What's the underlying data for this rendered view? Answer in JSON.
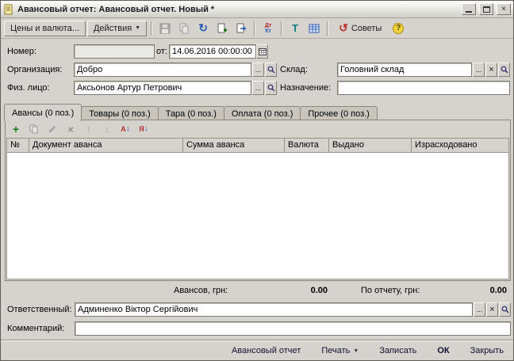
{
  "window": {
    "title": "Авансовый отчет: Авансовый отчет. Новый *"
  },
  "toolbar": {
    "prices_label": "Цены и валюта...",
    "actions_label": "Действия",
    "advices_label": "Советы"
  },
  "form": {
    "number_label": "Номер:",
    "number_value": "",
    "date_label": "от:",
    "date_value": "14.06.2016 00:00:00",
    "organization_label": "Организация:",
    "organization_value": "Добро",
    "warehouse_label": "Склад:",
    "warehouse_value": "Головний склад",
    "person_label": "Физ. лицо:",
    "person_value": "Аксьонов Артур Петрович",
    "purpose_label": "Назначение:",
    "purpose_value": "",
    "responsible_label": "Ответственный:",
    "responsible_value": "Админенко Віктор Сергійович",
    "comment_label": "Комментарий:",
    "comment_value": ""
  },
  "tabs": [
    {
      "label": "Авансы (0 поз.)"
    },
    {
      "label": "Товары (0 поз.)"
    },
    {
      "label": "Тара (0 поз.)"
    },
    {
      "label": "Оплата (0 поз.)"
    },
    {
      "label": "Прочее (0 поз.)"
    }
  ],
  "grid": {
    "columns": [
      "№",
      "Документ аванса",
      "Сумма аванса",
      "Валюта",
      "Выдано",
      "Израсходовано"
    ],
    "rows": []
  },
  "totals": {
    "advances_label": "Авансов, грн:",
    "advances_value": "0.00",
    "report_label": "По отчету, грн:",
    "report_value": "0.00"
  },
  "footer": {
    "report_button": "Авансовый отчет",
    "print_button": "Печать",
    "save_button": "Записать",
    "ok_button": "ОК",
    "close_button": "Закрыть"
  },
  "icons": {
    "close": "×",
    "dropdown": "▼",
    "reread": "↻",
    "advices": "↺",
    "help": "?",
    "dt": "Дт",
    "kt": "Кт",
    "add": "+",
    "delete": "×",
    "up": "↑",
    "down": "↓",
    "sort_letter_a": "А",
    "sort_letter_ya": "Я",
    "sort_arrow": "↓",
    "ellipsis": "...",
    "clear": "×",
    "goto": "Т"
  },
  "colors": {
    "window_bg": "#d6d3ce",
    "add_green": "#1d7a1d",
    "delete_red": "#b22222",
    "help_yellow": "#f0d23a",
    "accent_navy": "#2b2b6e"
  }
}
